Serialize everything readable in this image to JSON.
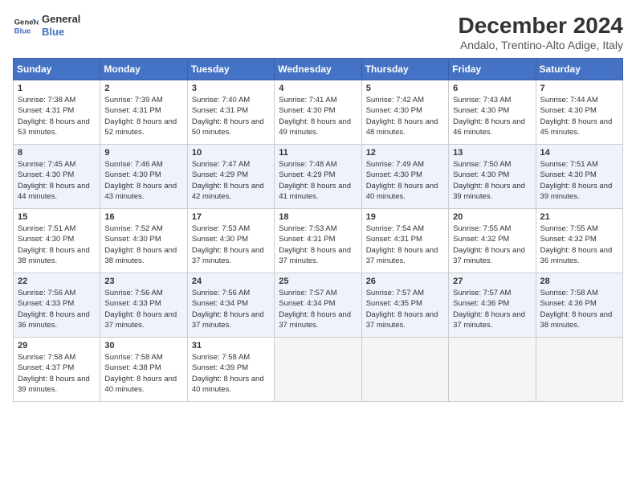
{
  "header": {
    "logo_line1": "General",
    "logo_line2": "Blue",
    "title": "December 2024",
    "location": "Andalo, Trentino-Alto Adige, Italy"
  },
  "columns": [
    "Sunday",
    "Monday",
    "Tuesday",
    "Wednesday",
    "Thursday",
    "Friday",
    "Saturday"
  ],
  "weeks": [
    [
      {
        "day": "1",
        "sunrise": "Sunrise: 7:38 AM",
        "sunset": "Sunset: 4:31 PM",
        "daylight": "Daylight: 8 hours and 53 minutes."
      },
      {
        "day": "2",
        "sunrise": "Sunrise: 7:39 AM",
        "sunset": "Sunset: 4:31 PM",
        "daylight": "Daylight: 8 hours and 52 minutes."
      },
      {
        "day": "3",
        "sunrise": "Sunrise: 7:40 AM",
        "sunset": "Sunset: 4:31 PM",
        "daylight": "Daylight: 8 hours and 50 minutes."
      },
      {
        "day": "4",
        "sunrise": "Sunrise: 7:41 AM",
        "sunset": "Sunset: 4:30 PM",
        "daylight": "Daylight: 8 hours and 49 minutes."
      },
      {
        "day": "5",
        "sunrise": "Sunrise: 7:42 AM",
        "sunset": "Sunset: 4:30 PM",
        "daylight": "Daylight: 8 hours and 48 minutes."
      },
      {
        "day": "6",
        "sunrise": "Sunrise: 7:43 AM",
        "sunset": "Sunset: 4:30 PM",
        "daylight": "Daylight: 8 hours and 46 minutes."
      },
      {
        "day": "7",
        "sunrise": "Sunrise: 7:44 AM",
        "sunset": "Sunset: 4:30 PM",
        "daylight": "Daylight: 8 hours and 45 minutes."
      }
    ],
    [
      {
        "day": "8",
        "sunrise": "Sunrise: 7:45 AM",
        "sunset": "Sunset: 4:30 PM",
        "daylight": "Daylight: 8 hours and 44 minutes."
      },
      {
        "day": "9",
        "sunrise": "Sunrise: 7:46 AM",
        "sunset": "Sunset: 4:30 PM",
        "daylight": "Daylight: 8 hours and 43 minutes."
      },
      {
        "day": "10",
        "sunrise": "Sunrise: 7:47 AM",
        "sunset": "Sunset: 4:29 PM",
        "daylight": "Daylight: 8 hours and 42 minutes."
      },
      {
        "day": "11",
        "sunrise": "Sunrise: 7:48 AM",
        "sunset": "Sunset: 4:29 PM",
        "daylight": "Daylight: 8 hours and 41 minutes."
      },
      {
        "day": "12",
        "sunrise": "Sunrise: 7:49 AM",
        "sunset": "Sunset: 4:30 PM",
        "daylight": "Daylight: 8 hours and 40 minutes."
      },
      {
        "day": "13",
        "sunrise": "Sunrise: 7:50 AM",
        "sunset": "Sunset: 4:30 PM",
        "daylight": "Daylight: 8 hours and 39 minutes."
      },
      {
        "day": "14",
        "sunrise": "Sunrise: 7:51 AM",
        "sunset": "Sunset: 4:30 PM",
        "daylight": "Daylight: 8 hours and 39 minutes."
      }
    ],
    [
      {
        "day": "15",
        "sunrise": "Sunrise: 7:51 AM",
        "sunset": "Sunset: 4:30 PM",
        "daylight": "Daylight: 8 hours and 38 minutes."
      },
      {
        "day": "16",
        "sunrise": "Sunrise: 7:52 AM",
        "sunset": "Sunset: 4:30 PM",
        "daylight": "Daylight: 8 hours and 38 minutes."
      },
      {
        "day": "17",
        "sunrise": "Sunrise: 7:53 AM",
        "sunset": "Sunset: 4:30 PM",
        "daylight": "Daylight: 8 hours and 37 minutes."
      },
      {
        "day": "18",
        "sunrise": "Sunrise: 7:53 AM",
        "sunset": "Sunset: 4:31 PM",
        "daylight": "Daylight: 8 hours and 37 minutes."
      },
      {
        "day": "19",
        "sunrise": "Sunrise: 7:54 AM",
        "sunset": "Sunset: 4:31 PM",
        "daylight": "Daylight: 8 hours and 37 minutes."
      },
      {
        "day": "20",
        "sunrise": "Sunrise: 7:55 AM",
        "sunset": "Sunset: 4:32 PM",
        "daylight": "Daylight: 8 hours and 37 minutes."
      },
      {
        "day": "21",
        "sunrise": "Sunrise: 7:55 AM",
        "sunset": "Sunset: 4:32 PM",
        "daylight": "Daylight: 8 hours and 36 minutes."
      }
    ],
    [
      {
        "day": "22",
        "sunrise": "Sunrise: 7:56 AM",
        "sunset": "Sunset: 4:33 PM",
        "daylight": "Daylight: 8 hours and 36 minutes."
      },
      {
        "day": "23",
        "sunrise": "Sunrise: 7:56 AM",
        "sunset": "Sunset: 4:33 PM",
        "daylight": "Daylight: 8 hours and 37 minutes."
      },
      {
        "day": "24",
        "sunrise": "Sunrise: 7:56 AM",
        "sunset": "Sunset: 4:34 PM",
        "daylight": "Daylight: 8 hours and 37 minutes."
      },
      {
        "day": "25",
        "sunrise": "Sunrise: 7:57 AM",
        "sunset": "Sunset: 4:34 PM",
        "daylight": "Daylight: 8 hours and 37 minutes."
      },
      {
        "day": "26",
        "sunrise": "Sunrise: 7:57 AM",
        "sunset": "Sunset: 4:35 PM",
        "daylight": "Daylight: 8 hours and 37 minutes."
      },
      {
        "day": "27",
        "sunrise": "Sunrise: 7:57 AM",
        "sunset": "Sunset: 4:36 PM",
        "daylight": "Daylight: 8 hours and 37 minutes."
      },
      {
        "day": "28",
        "sunrise": "Sunrise: 7:58 AM",
        "sunset": "Sunset: 4:36 PM",
        "daylight": "Daylight: 8 hours and 38 minutes."
      }
    ],
    [
      {
        "day": "29",
        "sunrise": "Sunrise: 7:58 AM",
        "sunset": "Sunset: 4:37 PM",
        "daylight": "Daylight: 8 hours and 39 minutes."
      },
      {
        "day": "30",
        "sunrise": "Sunrise: 7:58 AM",
        "sunset": "Sunset: 4:38 PM",
        "daylight": "Daylight: 8 hours and 40 minutes."
      },
      {
        "day": "31",
        "sunrise": "Sunrise: 7:58 AM",
        "sunset": "Sunset: 4:39 PM",
        "daylight": "Daylight: 8 hours and 40 minutes."
      },
      null,
      null,
      null,
      null
    ]
  ]
}
